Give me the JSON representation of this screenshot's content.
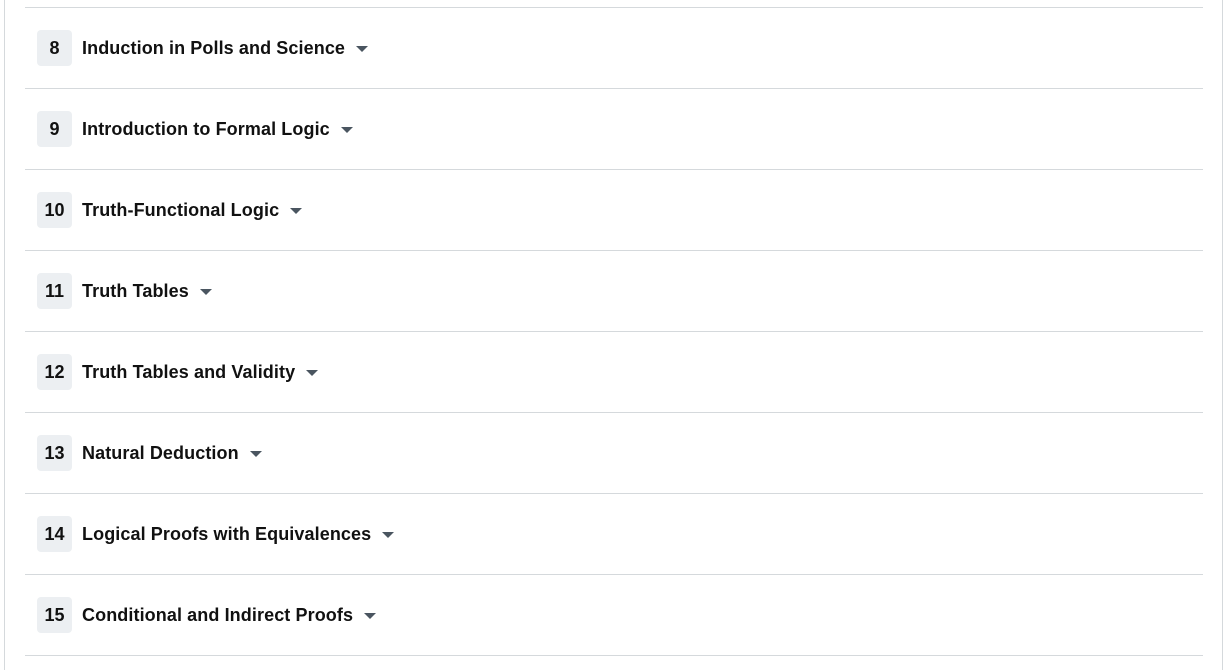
{
  "chapters": [
    {
      "number": "8",
      "title": "Induction in Polls and Science"
    },
    {
      "number": "9",
      "title": "Introduction to Formal Logic"
    },
    {
      "number": "10",
      "title": "Truth-Functional Logic"
    },
    {
      "number": "11",
      "title": "Truth Tables"
    },
    {
      "number": "12",
      "title": "Truth Tables and Validity"
    },
    {
      "number": "13",
      "title": "Natural Deduction"
    },
    {
      "number": "14",
      "title": "Logical Proofs with Equivalences"
    },
    {
      "number": "15",
      "title": "Conditional and Indirect Proofs"
    }
  ]
}
